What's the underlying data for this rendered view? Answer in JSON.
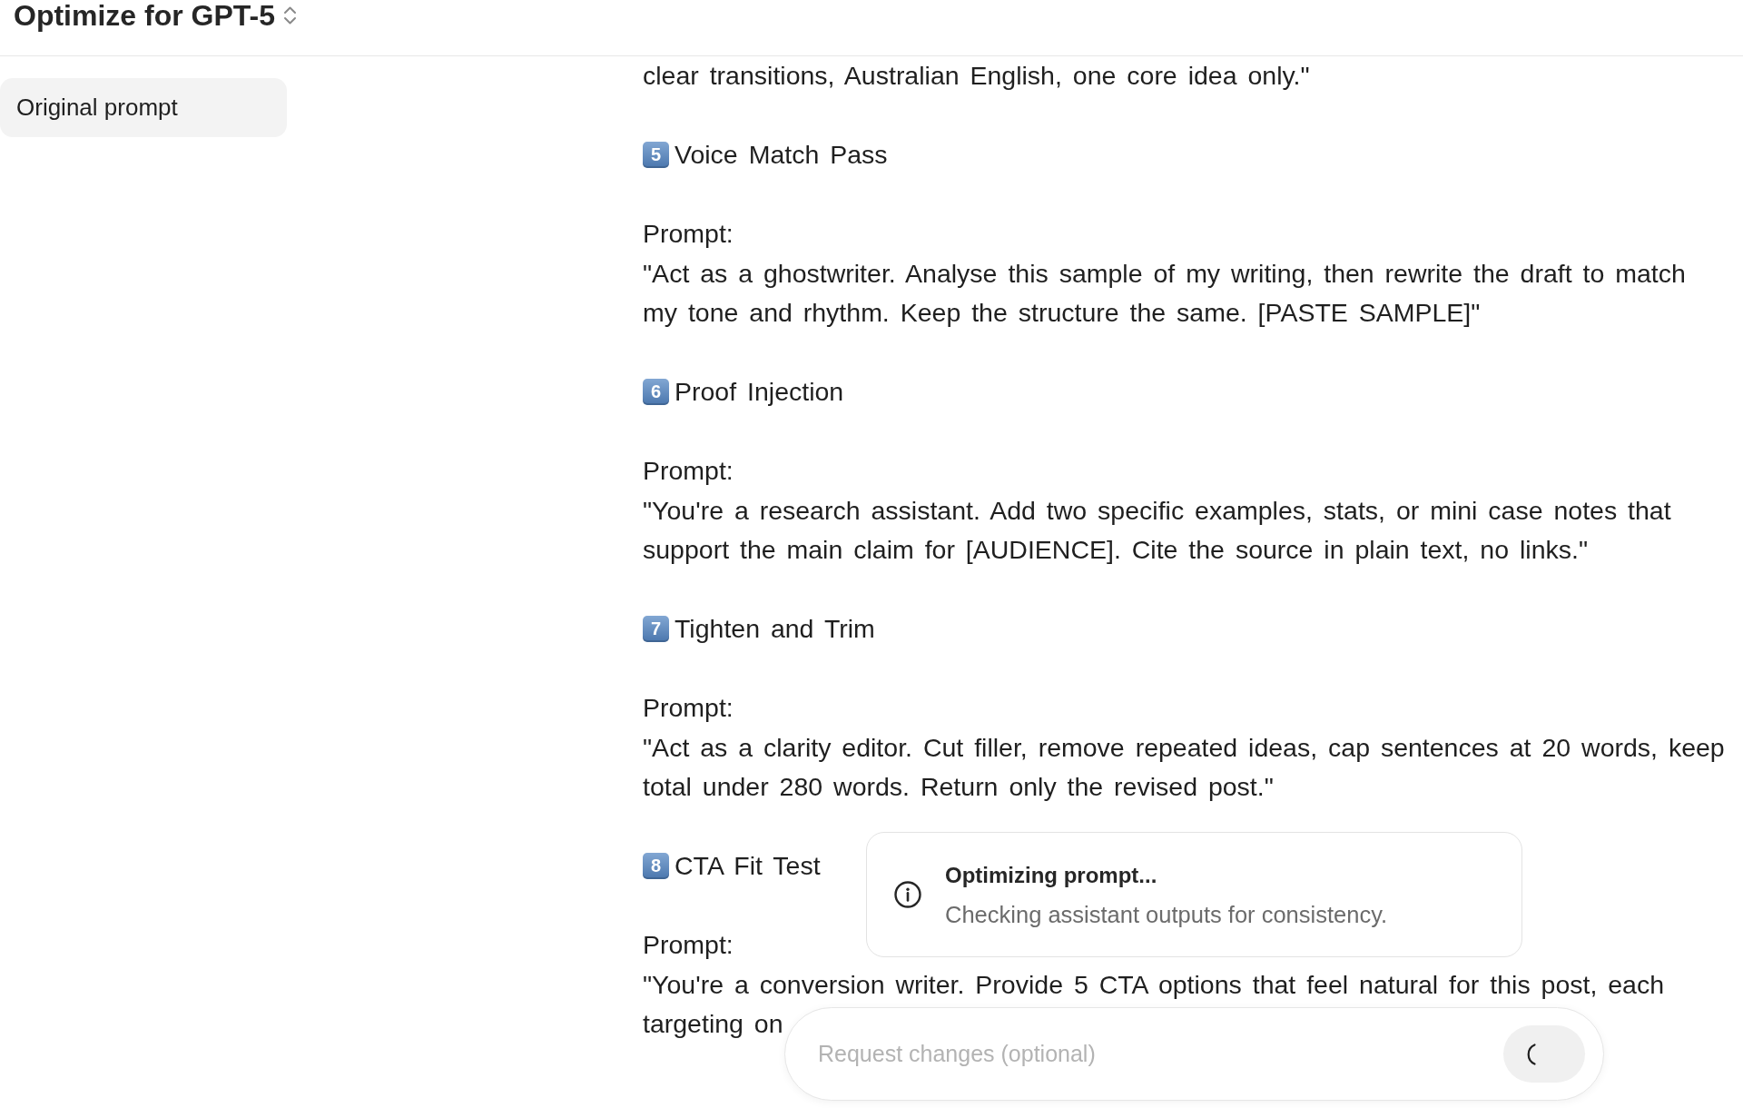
{
  "header": {
    "title": "Optimize for GPT-5"
  },
  "sidebar": {
    "items": [
      {
        "label": "Original prompt",
        "selected": true
      }
    ]
  },
  "document": {
    "leading_text": "clear transitions, Australian English, one core idea only.\"",
    "sections": [
      {
        "number": "5",
        "title": "Voice Match Pass",
        "label": "Prompt:",
        "text": "\"Act as a ghostwriter. Analyse this sample of my writing, then rewrite the draft to match my tone and rhythm. Keep the structure the same. [PASTE SAMPLE]\""
      },
      {
        "number": "6",
        "title": "Proof Injection",
        "label": "Prompt:",
        "text": "\"You're a research assistant. Add two specific examples, stats, or mini case notes that support the main claim for [AUDIENCE]. Cite the source in plain text, no links.\""
      },
      {
        "number": "7",
        "title": "Tighten and Trim",
        "label": "Prompt:",
        "text": "\"Act as a clarity editor. Cut filler, remove repeated ideas, cap sentences at 20 words, keep total under 280 words. Return only the revised post.\""
      },
      {
        "number": "8",
        "title": "CTA Fit Test",
        "label": "Prompt:",
        "text": "\"You're a conversion writer. Provide 5 CTA options that feel natural for this post, each targeting on"
      }
    ]
  },
  "toast": {
    "title": "Optimizing prompt...",
    "message": "Checking assistant outputs for consistency."
  },
  "request_bar": {
    "placeholder": "Request changes (optional)"
  }
}
